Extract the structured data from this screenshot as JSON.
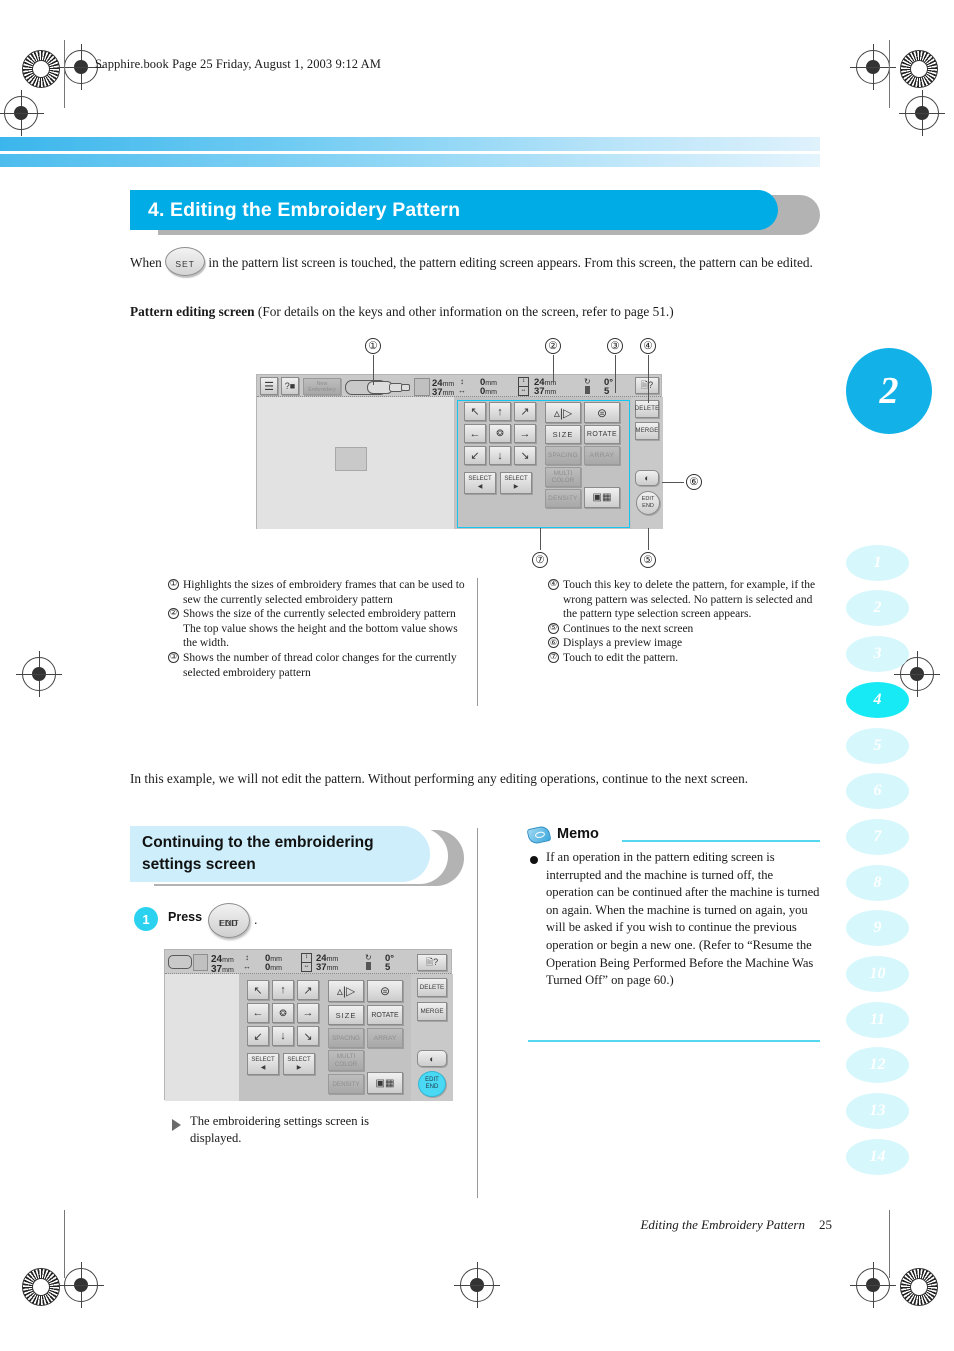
{
  "header": {
    "book_line": "Sapphire.book  Page 25  Friday, August 1, 2003  9:12 AM"
  },
  "section": {
    "title": "4. Editing the Embroidery Pattern",
    "intro_before": "When",
    "set_key_label": "SET",
    "intro_after": "in the pattern list screen is touched, the pattern editing screen appears. From this screen, the pattern can be edited.",
    "screen_label": "Pattern editing screen",
    "screen_note": "(For details on the keys and other information on the screen, refer to page 51.)"
  },
  "lcd": {
    "info": {
      "vertical_offset": "0",
      "vertical_offset_unit": "mm",
      "horizontal_offset": "0",
      "horizontal_offset_unit": "mm",
      "height": "24",
      "height_unit": "mm",
      "width": "37",
      "width_unit": "mm",
      "rotation": "0",
      "rotation_unit": "°",
      "color_changes": "5"
    },
    "frame_sizes": {
      "size_1": "24",
      "size_1_unit": "mm",
      "size_2": "37",
      "size_2_unit": "mm"
    },
    "top_keys": [
      {
        "name": "settings-key",
        "label": ""
      },
      {
        "name": "guide-key",
        "label": ""
      },
      {
        "name": "new-embroidery-key",
        "label": "New\nEmbroidery"
      }
    ],
    "move_keys": [
      {
        "name": "move-up-left",
        "glyph": "↖"
      },
      {
        "name": "move-up",
        "glyph": "↑"
      },
      {
        "name": "move-up-right",
        "glyph": "↗"
      },
      {
        "name": "move-left",
        "glyph": "←"
      },
      {
        "name": "move-center",
        "glyph": "✤"
      },
      {
        "name": "move-right",
        "glyph": "→"
      },
      {
        "name": "move-down-left",
        "glyph": "↙"
      },
      {
        "name": "move-down",
        "glyph": "↓"
      },
      {
        "name": "move-down-right",
        "glyph": "↘"
      }
    ],
    "select_prev": "SELECT",
    "select_next": "SELECT",
    "edit_keys": [
      {
        "name": "horizontal-mirror-key",
        "label": "",
        "state": "enabled"
      },
      {
        "name": "vertical-mirror-key",
        "label": "",
        "state": "enabled"
      },
      {
        "name": "size-key",
        "label": "SIZE",
        "state": "enabled"
      },
      {
        "name": "rotate-key",
        "label": "ROTATE",
        "state": "enabled"
      },
      {
        "name": "spacing-key",
        "label": "SPACING",
        "state": "disabled"
      },
      {
        "name": "array-key",
        "label": "ARRAY",
        "state": "disabled"
      },
      {
        "name": "multi-color-key",
        "label": "MULTI COLOR",
        "state": "disabled"
      },
      {
        "name": "density-key",
        "label": "DENSITY",
        "state": "disabled"
      },
      {
        "name": "thread-palette-key",
        "label": "",
        "state": "enabled"
      }
    ],
    "right_keys": [
      {
        "name": "memory-help-key",
        "label": ""
      },
      {
        "name": "delete-key",
        "label": "DELETE"
      },
      {
        "name": "merge-key",
        "label": "MERGE"
      },
      {
        "name": "preview-key",
        "label": ""
      },
      {
        "name": "edit-end-key",
        "label": "EDIT END"
      }
    ]
  },
  "callouts": [
    {
      "id": "1",
      "marker": "①"
    },
    {
      "id": "2",
      "marker": "②"
    },
    {
      "id": "3",
      "marker": "③"
    },
    {
      "id": "4",
      "marker": "④"
    },
    {
      "id": "5",
      "marker": "⑤"
    },
    {
      "id": "6",
      "marker": "⑥"
    },
    {
      "id": "7",
      "marker": "⑦"
    }
  ],
  "caption_left": [
    {
      "marker": "①",
      "text": "Highlights the sizes of embroidery frames that can be used to sew the currently selected embroidery pattern"
    },
    {
      "marker": "②",
      "text": "Shows the size of the currently selected embroidery pattern The top value shows the height and the bottom value shows the width."
    },
    {
      "marker": "③",
      "text": "Shows the number of thread color changes for the currently selected embroidery pattern"
    }
  ],
  "caption_right": [
    {
      "marker": "④",
      "text": "Touch this key to delete the pattern, for example, if the wrong pattern was selected. No pattern is selected and the pattern type selection screen appears."
    },
    {
      "marker": "⑤",
      "text": "Continues to the next screen"
    },
    {
      "marker": "⑥",
      "text": "Displays a preview image"
    },
    {
      "marker": "⑦",
      "text": "Touch to edit the pattern."
    }
  ],
  "middle_paragraph": "In this example, we will not edit the pattern. Without performing any editing operations, continue to the next screen.",
  "subsection": {
    "title_line1": "Continuing to the embroidering",
    "title_line2": "settings screen",
    "step_number": "1",
    "press_label": "Press",
    "press_key_line1": "EDIT",
    "press_key_line2": "END",
    "press_period": ".",
    "result_text": "The embroidering settings screen is displayed."
  },
  "memo": {
    "title": "Memo",
    "body": "If an operation in the pattern editing screen is interrupted and the machine is turned off, the operation can be continued after the machine is turned on again. When the machine is turned on again, you will be asked if you wish to continue the previous operation or begin a new one. (Refer to “Resume the Operation Being Performed Before the Machine Was Turned Off” on page 60.)"
  },
  "chapter_tab_big": "2",
  "chapter_tabs": [
    {
      "label": "1",
      "active": false
    },
    {
      "label": "2",
      "active": false
    },
    {
      "label": "3",
      "active": false
    },
    {
      "label": "4",
      "active": true
    },
    {
      "label": "5",
      "active": false
    },
    {
      "label": "6",
      "active": false
    },
    {
      "label": "7",
      "active": false
    },
    {
      "label": "8",
      "active": false
    },
    {
      "label": "9",
      "active": false
    },
    {
      "label": "10",
      "active": false
    },
    {
      "label": "11",
      "active": false
    },
    {
      "label": "12",
      "active": false
    },
    {
      "label": "13",
      "active": false
    },
    {
      "label": "14",
      "active": false
    }
  ],
  "footer": {
    "title": "Editing the Embroidery Pattern",
    "page": "25"
  },
  "colors": {
    "accent": "#00ace6",
    "banner_shadow": "#b3b3b3",
    "subsection_fill": "#cdeefa",
    "tab_active": "#18eaf5",
    "tab_inactive": "#d6f7fb",
    "callout": "#16c6f2"
  }
}
